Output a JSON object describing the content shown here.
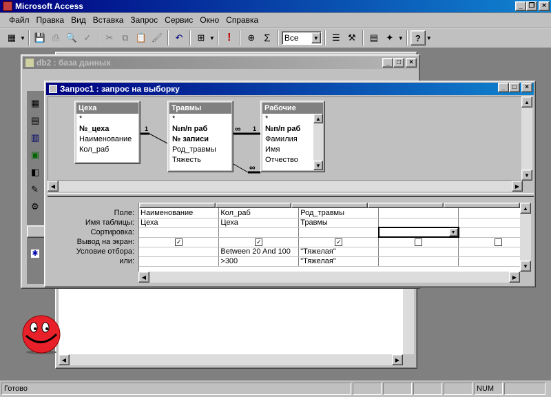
{
  "app": {
    "title": "Microsoft Access"
  },
  "menu": [
    "Файл",
    "Правка",
    "Вид",
    "Вставка",
    "Запрос",
    "Сервис",
    "Окно",
    "Справка"
  ],
  "toolbar": {
    "combo_value": "Все"
  },
  "db_window": {
    "title": "db2 : база данных"
  },
  "query_window": {
    "title": "Запрос1 : запрос на выборку"
  },
  "tables": [
    {
      "name": "Цеха",
      "fields": [
        {
          "t": "*",
          "bold": false
        },
        {
          "t": "№_цеха",
          "bold": true
        },
        {
          "t": "Наименование",
          "bold": false
        },
        {
          "t": "Кол_раб",
          "bold": false
        }
      ]
    },
    {
      "name": "Травмы",
      "fields": [
        {
          "t": "*",
          "bold": false
        },
        {
          "t": "№п/п раб",
          "bold": true
        },
        {
          "t": "№ записи",
          "bold": true
        },
        {
          "t": "Род_травмы",
          "bold": false
        },
        {
          "t": "Тяжесть",
          "bold": false
        }
      ]
    },
    {
      "name": "Рабочие",
      "fields": [
        {
          "t": "*",
          "bold": false
        },
        {
          "t": "№п/п раб",
          "bold": true
        },
        {
          "t": "Фамилия",
          "bold": false
        },
        {
          "t": "Имя",
          "bold": false
        },
        {
          "t": "Отчество",
          "bold": false
        }
      ]
    }
  ],
  "relations": {
    "one": "1",
    "many": "∞"
  },
  "grid": {
    "row_labels": [
      "Поле:",
      "Имя таблицы:",
      "Сортировка:",
      "Вывод на экран:",
      "Условие отбора:",
      "или:"
    ],
    "columns": [
      {
        "field": "Наименование",
        "table": "Цеха",
        "sort": "",
        "show": true,
        "criteria": "",
        "or": ""
      },
      {
        "field": "Кол_раб",
        "table": "Цеха",
        "sort": "",
        "show": true,
        "criteria": "Between 20 And 100",
        "or": ">300"
      },
      {
        "field": "Род_травмы",
        "table": "Травмы",
        "sort": "",
        "show": true,
        "criteria": "\"Тяжелая\"",
        "or": "\"Тяжелая\""
      },
      {
        "field": "",
        "table": "",
        "sort": "",
        "show": false,
        "criteria": "",
        "or": ""
      },
      {
        "field": "",
        "table": "",
        "sort": "",
        "show": false,
        "criteria": "",
        "or": ""
      }
    ]
  },
  "status": {
    "text": "Готово",
    "num": "NUM"
  }
}
